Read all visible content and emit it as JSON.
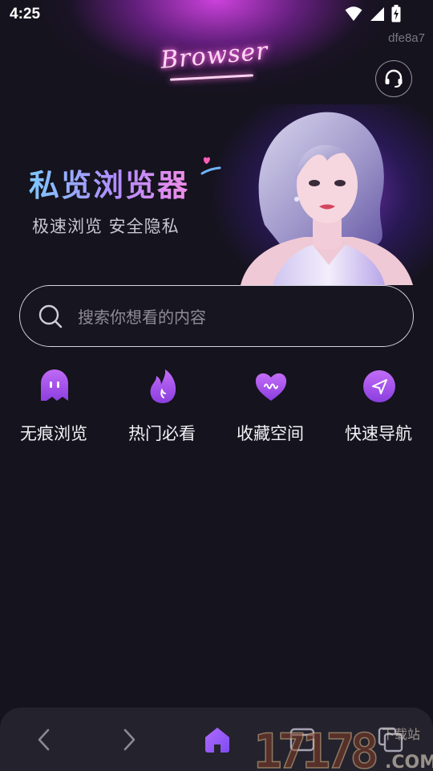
{
  "status_bar": {
    "time": "4:25"
  },
  "device_id": "dfe8a7",
  "logo_text": "Browser",
  "banner": {
    "title": "私览浏览器",
    "subtitle": "极速浏览 安全隐私"
  },
  "search": {
    "placeholder": "搜索你想看的内容"
  },
  "quick_actions": [
    {
      "label": "无痕浏览",
      "icon": "ghost-icon"
    },
    {
      "label": "热门必看",
      "icon": "flame-icon"
    },
    {
      "label": "收藏空间",
      "icon": "heart-icon"
    },
    {
      "label": "快速导航",
      "icon": "navigation-icon"
    }
  ],
  "bottom_nav": [
    "back-icon",
    "forward-icon",
    "home-icon",
    "tabs-icon",
    "windows-icon"
  ],
  "watermark": {
    "number": "17178",
    "suffix": ".COM",
    "tag": "下载站"
  },
  "colors": {
    "accent": "#a24cf0",
    "background": "#15131d",
    "glow": "#d644e6"
  }
}
